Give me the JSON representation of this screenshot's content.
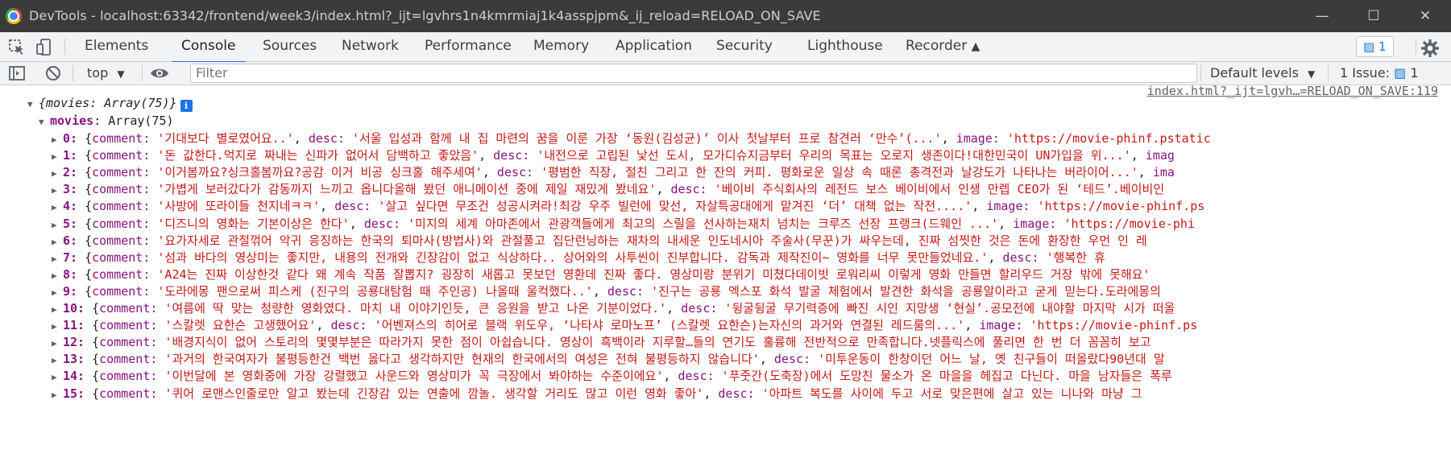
{
  "window": {
    "title": "DevTools - localhost:63342/frontend/week3/index.html?_ijt=lgvhrs1n4kmrmiaj1k4asspjpm&_ij_reload=RELOAD_ON_SAVE",
    "minimize_icon": "minimize-icon",
    "maximize_icon": "maximize-icon",
    "close_icon": "close-icon"
  },
  "tabs": [
    {
      "label": "Elements"
    },
    {
      "label": "Console"
    },
    {
      "label": "Sources"
    },
    {
      "label": "Network"
    },
    {
      "label": "Performance"
    },
    {
      "label": "Memory"
    },
    {
      "label": "Application"
    },
    {
      "label": "Security"
    },
    {
      "label": "Lighthouse"
    },
    {
      "label": "Recorder"
    }
  ],
  "active_tab": "Console",
  "issues_badge": "1",
  "toolbar": {
    "context": "top",
    "filter_placeholder": "Filter",
    "levels": "Default levels",
    "issue_label": "1 Issue:",
    "issue_count": "1"
  },
  "console": {
    "source_link": "index.html?_ijt=lgvh…=RELOAD_ON_SAVE:119",
    "root_label": "{movies: Array(75)}",
    "info_mark": "i",
    "movies_key": "movies",
    "movies_value": "Array(75)",
    "rows": [
      {
        "index": "0:",
        "comment": "'기대보다 별로였어요..'",
        "second_key": "desc:",
        "second": "'서울 입성과 함께 내 집 마련의 꿈을 이룬 가장 ‘동원(김성균)’ 이사 첫날부터 프로 참견러 ‘만수’(...'",
        "third_key": "image:",
        "third": "'https://movie-phinf.pstatic"
      },
      {
        "index": "1:",
        "comment": "'돈 값한다.억지로 짜내는 신파가 없어서 담백하고 좋았음'",
        "second_key": "desc:",
        "second": "'내전으로 고립된 낯선 도시, 모가디슈지금부터 우리의 목표는 오로지 생존이다!대한민국이 UN가입을 위...'",
        "third_key": "imag",
        "third": ""
      },
      {
        "index": "2:",
        "comment": "'이거봄까요?싱크홀봄까요?공감 이거 비공 싱크홀 해주세여'",
        "second_key": "desc:",
        "second": "'평범한 직장, 절친 그리고 한 잔의 커피. 평화로운 일상 속 때론 총격전과 날강도가 나타나는 버라이어...'",
        "third_key": "ima",
        "third": ""
      },
      {
        "index": "3:",
        "comment": "'가볍게 보러갔다가 감동까지 느끼고 옵니다올해 봤던 애니메이션 중에 제일 재밌게 봤네요'",
        "second_key": "desc:",
        "second": "'베이비 주식회사의 레전드 보스 베이비에서 인생 만렙 CEO가 된 ‘테드’.베이비인",
        "third_key": "",
        "third": ""
      },
      {
        "index": "4:",
        "comment": "'사방에 또라이들 천지네ㅋㅋ'",
        "second_key": "desc:",
        "second": "'살고 싶다면 무조건 성공시켜라!최강 우주 빌런에 맞선, 자살특공대에게 맡겨진 ‘더’ 대책 없는 작전....'",
        "third_key": "image:",
        "third": "'https://movie-phinf.ps"
      },
      {
        "index": "5:",
        "comment": "'디즈니의 영화는 기본이상은 한다'",
        "second_key": "desc:",
        "second": "'미지의 세계 아마존에서 관광객들에게 최고의 스릴을 선사하는재치 넘치는 크루즈 선장 프랭크(드웨인 ...'",
        "third_key": "image:",
        "third": "'https://movie-phi"
      },
      {
        "index": "6:",
        "comment": "'요가자세로 관절꺾어 악귀 응징하는  한국의 퇴마사(방법사)와 관절풀고 집단런닝하는 재차의 내세운 인도네시아 주술사(무꾼)가 싸우는데, 진짜 섬찟한 것은 돈에 환장한 우먼 인 레",
        "second_key": "",
        "second": "",
        "third_key": "",
        "third": ""
      },
      {
        "index": "7:",
        "comment": "'섬과  바다의 영상미는  좋지만,  내용의 전개와  긴장감이  없고  식상하다.. 상어와의 사투씬이 진부합니다. 감독과  제작진이~ 영화를  너무  못만들었네요.'",
        "second_key": "desc:",
        "second": "'행복한 휴",
        "third_key": "",
        "third": ""
      },
      {
        "index": "8:",
        "comment": "'A24는 진짜 이상한것 같다 왜 계속 작품 잘뽑지? 굉장히 새롭고 못보던 영환데 진짜 좋다. 영상미랑 분위기 미쳤다데이빗 로워리씨 이렇게 영화 만들면 할리우드 거장 밖에 못해요'",
        "second_key": "",
        "second": "",
        "third_key": "",
        "third": ""
      },
      {
        "index": "9:",
        "comment": "'도라에몽 팬으로써 피스케 (진구의 공룡대탐험 때 주인공) 나올때 울컥했다..'",
        "second_key": "desc:",
        "second": "'진구는 공룡 엑스포 화석 발굴 체험에서 발견한 화석을 공룡알이라고 굳게 믿는다.도라에몽의",
        "third_key": "",
        "third": ""
      },
      {
        "index": "10:",
        "comment": "'여름에 딱 맞는 청량한 영화였다. 마치 내 이야기인듯, 큰 응원을 받고 나온 기분이었다.'",
        "second_key": "desc:",
        "second": "'뒹굴뒹굴 무기력증에 빠진 시인 지망생 ‘현실’.공모전에 내야할 마지막 시가 떠올",
        "third_key": "",
        "third": ""
      },
      {
        "index": "11:",
        "comment": "'스칼렛 요한슨  고생했어요'",
        "second_key": "desc:",
        "second": "'어벤져스의 히어로 블랙 위도우, ‘나타샤 로마노프’ (스칼렛 요한슨)는자신의 과거와 연결된 레드룸의...'",
        "third_key": "image:",
        "third": "'https://movie-phinf.ps"
      },
      {
        "index": "12:",
        "comment": "'배경지식이 없어 스토리의 몇몇부분은 따라가지 못한 점이 아쉽습니다. 영상이 흑백이라 지루할…들의 연기도 훌륭해 전반적으로 만족합니다.넷플릭스에 풀리면 한 번 더 꼼꼼히 보고",
        "second_key": "",
        "second": "",
        "third_key": "",
        "third": ""
      },
      {
        "index": "13:",
        "comment": "'과거의 한국여자가 불평등한건 백번 옳다고 생각하지만 현재의 한국에서의 여성은 전혀 불평등하지 않습니다'",
        "second_key": "desc:",
        "second": "'미투운동이 한창이던 어느 날, 옛 친구들이 떠올랐다90년대 말",
        "third_key": "",
        "third": ""
      },
      {
        "index": "14:",
        "comment": "'이번달에 본 영화중에 가장 강렬했고 사운드와 영상미가 꼭 극장에서 봐야하는 수준이에요'",
        "second_key": "desc:",
        "second": "'푸줏간(도축장)에서 도망친 물소가 온 마을을 헤집고 다닌다. 마을 남자들은 폭루",
        "third_key": "",
        "third": ""
      },
      {
        "index": "15:",
        "comment": "'퀴어 로맨스인줄로만 알고 봤는데 긴장감 있는 연출에 깜놀. 생각할 거리도 많고 이런 영화 좋아'",
        "second_key": "desc:",
        "second": "'아파트 복도를 사이에 두고 서로 맞은편에 살고 있는 니나와 마냥 그",
        "third_key": "",
        "third": ""
      }
    ]
  }
}
